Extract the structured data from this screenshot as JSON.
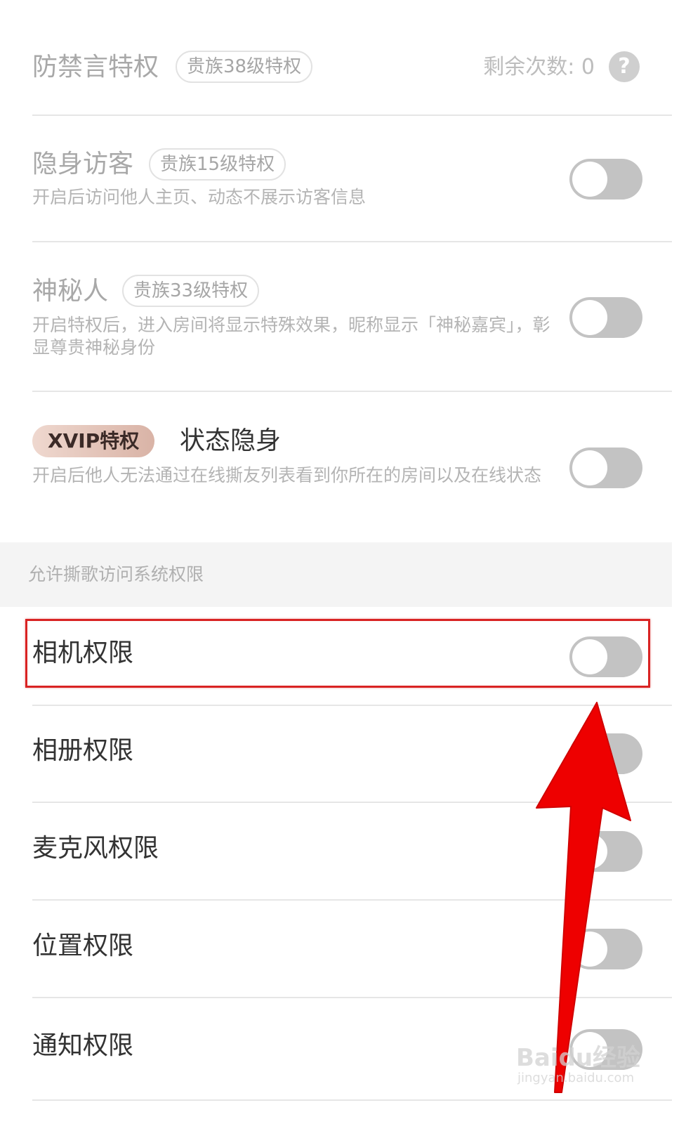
{
  "privileges": {
    "anti_mute": {
      "title": "防禁言特权",
      "tag": "贵族38级特权",
      "remaining_label": "剩余次数:",
      "remaining_count": "0"
    },
    "stealth_visitor": {
      "title": "隐身访客",
      "tag": "贵族15级特权",
      "desc": "开启后访问他人主页、动态不展示访客信息",
      "enabled": false
    },
    "mystery_person": {
      "title": "神秘人",
      "tag": "贵族33级特权",
      "desc": "开启特权后，进入房间将显示特殊效果，昵称显示「神秘嘉宾」，彰显尊贵神秘身份",
      "enabled": false
    },
    "status_stealth": {
      "badge": "XVIP特权",
      "title": "状态隐身",
      "desc": "开启后他人无法通过在线撕友列表看到你所在的房间以及在线状态",
      "enabled": false
    }
  },
  "section_header": "允许撕歌访问系统权限",
  "permissions": [
    {
      "label": "相机权限",
      "enabled": false
    },
    {
      "label": "相册权限",
      "enabled": false
    },
    {
      "label": "麦克风权限",
      "enabled": false
    },
    {
      "label": "位置权限",
      "enabled": false
    },
    {
      "label": "通知权限",
      "enabled": false
    }
  ],
  "watermark": {
    "main": "Baidu经验",
    "sub": "jingyan.baidu.com"
  },
  "colors": {
    "toggle_off": "#c3c3c3",
    "highlight": "#d92323",
    "arrow": "#ee0000"
  }
}
